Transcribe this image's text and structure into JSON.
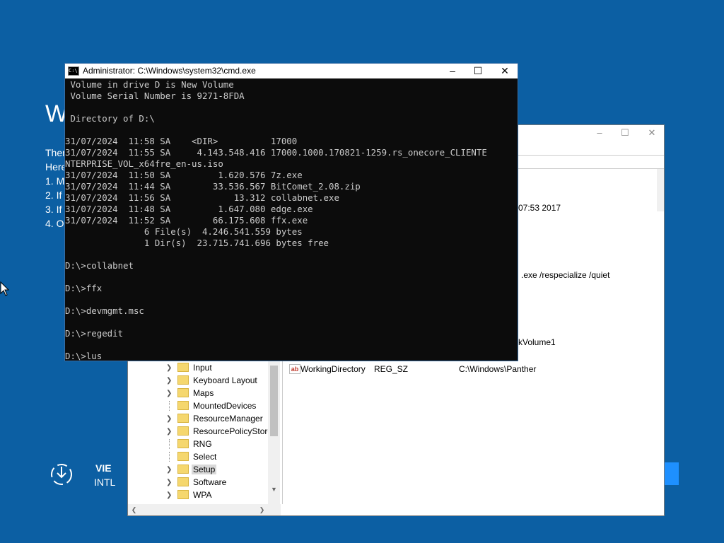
{
  "background": {
    "title": "W",
    "lines": [
      "There",
      "Here",
      "1. M",
      "2. If",
      "3. If",
      "4. O"
    ],
    "language_primary": "VIE",
    "language_secondary": "INTL"
  },
  "regedit": {
    "tree_items": [
      {
        "label": "Input",
        "expandable": true,
        "selected": false
      },
      {
        "label": "Keyboard Layout",
        "expandable": true,
        "selected": false
      },
      {
        "label": "Maps",
        "expandable": true,
        "selected": false
      },
      {
        "label": "MountedDevices",
        "expandable": false,
        "selected": false
      },
      {
        "label": "ResourceManager",
        "expandable": true,
        "selected": false
      },
      {
        "label": "ResourcePolicyStore",
        "expandable": true,
        "selected": false
      },
      {
        "label": "RNG",
        "expandable": false,
        "selected": false
      },
      {
        "label": "Select",
        "expandable": false,
        "selected": false
      },
      {
        "label": "Setup",
        "expandable": true,
        "selected": true
      },
      {
        "label": "Software",
        "expandable": true,
        "selected": false
      },
      {
        "label": "WPA",
        "expandable": true,
        "selected": false
      }
    ],
    "value_row": {
      "icon_text": "ab",
      "name": "WorkingDirectory",
      "type": "REG_SZ",
      "data": "C:\\Windows\\Panther"
    },
    "partial_values": [
      "07:53 2017",
      ".exe /respecialize /quiet",
      "kVolume1"
    ]
  },
  "cmd": {
    "title": "Administrator: C:\\Windows\\system32\\cmd.exe",
    "icon_text": "C:\\",
    "lines": [
      " Volume in drive D is New Volume",
      " Volume Serial Number is 9271-8FDA",
      "",
      " Directory of D:\\",
      "",
      "31/07/2024  11:58 SA    <DIR>          17000",
      "31/07/2024  11:55 SA     4.143.548.416 17000.1000.170821-1259.rs_onecore_CLIENTE",
      "NTERPRISE_VOL_x64fre_en-us.iso",
      "31/07/2024  11:50 SA         1.620.576 7z.exe",
      "31/07/2024  11:44 SA        33.536.567 BitComet_2.08.zip",
      "31/07/2024  11:56 SA            13.312 collabnet.exe",
      "31/07/2024  11:48 SA         1.647.080 edge.exe",
      "31/07/2024  11:52 SA        66.175.608 ffx.exe",
      "               6 File(s)  4.246.541.559 bytes",
      "               1 Dir(s)  23.715.741.696 bytes free",
      "",
      "D:\\>collabnet",
      "",
      "D:\\>ffx",
      "",
      "D:\\>devmgmt.msc",
      "",
      "D:\\>regedit",
      "",
      "D:\\>lus"
    ]
  }
}
